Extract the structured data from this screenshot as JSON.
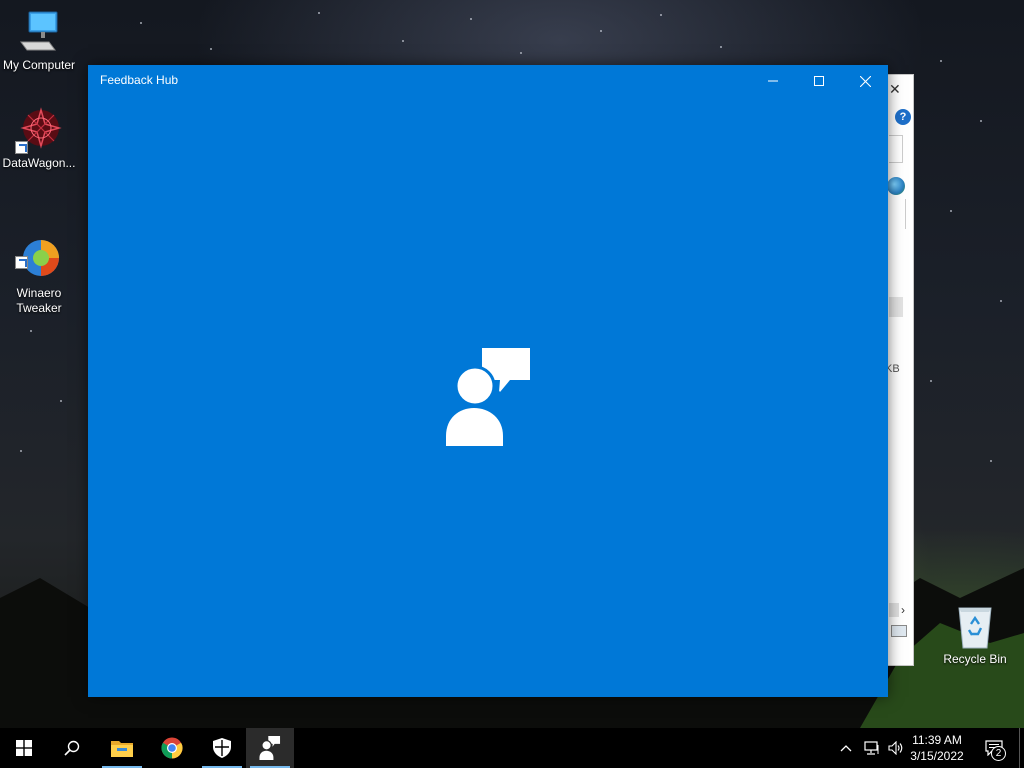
{
  "desktop": {
    "icons": [
      {
        "label": "My Computer",
        "icon": "computer-icon"
      },
      {
        "label": "DataWagon...",
        "icon": "datawagon-icon"
      },
      {
        "label": "Winaero\nTweaker",
        "icon": "winaero-tweaker-icon"
      },
      {
        "label": "Recycle Bin",
        "icon": "recycle-bin-icon"
      }
    ]
  },
  "background_window": {
    "partial_text": "KB"
  },
  "window": {
    "title": "Feedback Hub",
    "app_icon": "feedback-hub-icon",
    "accent_color": "#0078d7",
    "controls": [
      "minimize-icon",
      "maximize-icon",
      "close-icon"
    ]
  },
  "taskbar": {
    "pinned": [
      {
        "name": "start",
        "icon": "windows-start-icon"
      },
      {
        "name": "search",
        "icon": "search-icon"
      },
      {
        "name": "file-explorer",
        "icon": "folder-icon",
        "running": true
      },
      {
        "name": "chrome",
        "icon": "chrome-icon"
      },
      {
        "name": "windows-security",
        "icon": "shield-icon",
        "running": true
      },
      {
        "name": "feedback-hub",
        "icon": "feedback-hub-icon",
        "active": true
      }
    ],
    "clock": {
      "time": "11:39 AM",
      "date": "3/15/2022"
    },
    "notification_count": "2"
  }
}
